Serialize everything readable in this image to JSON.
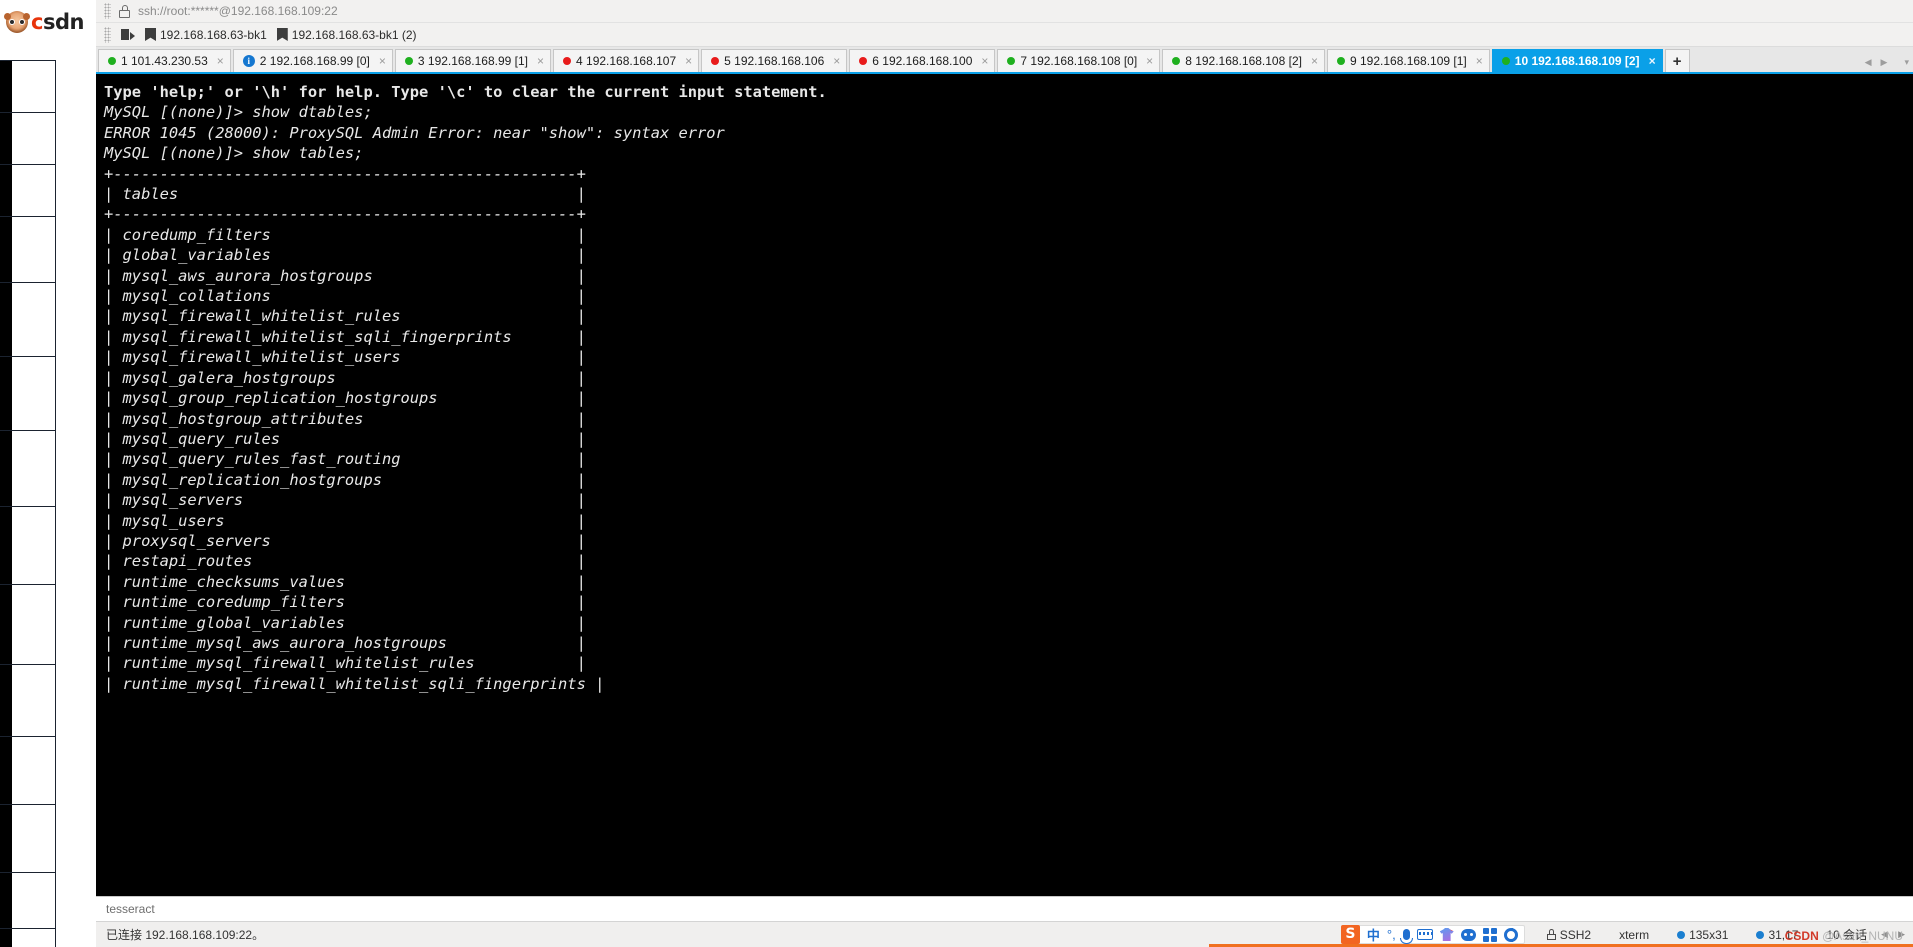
{
  "branding": {
    "logo_text": "csdn",
    "logo_first_letter": "c"
  },
  "addressbar": {
    "lock_icon": "lock-icon",
    "path": "ssh://root:******@192.168.168.109:22"
  },
  "bookmarkbar": {
    "export_icon": "export-session-icon",
    "items": [
      {
        "icon": "bookmark-icon",
        "label": "192.168.168.63-bk1"
      },
      {
        "icon": "bookmark-icon",
        "label": "192.168.168.63-bk1 (2)"
      }
    ]
  },
  "tabs": [
    {
      "index": "1",
      "status": "green",
      "label": "1 101.43.230.53",
      "active": false,
      "close": "×"
    },
    {
      "index": "2",
      "status": "info",
      "label": "2 192.168.168.99 [0]",
      "active": false,
      "close": "×"
    },
    {
      "index": "3",
      "status": "green",
      "label": "3 192.168.168.99 [1]",
      "active": false,
      "close": "×"
    },
    {
      "index": "4",
      "status": "red",
      "label": "4 192.168.168.107",
      "active": false,
      "close": "×"
    },
    {
      "index": "5",
      "status": "red",
      "label": "5 192.168.168.106",
      "active": false,
      "close": "×"
    },
    {
      "index": "6",
      "status": "red",
      "label": "6 192.168.168.100",
      "active": false,
      "close": "×"
    },
    {
      "index": "7",
      "status": "green",
      "label": "7 192.168.168.108 [0]",
      "active": false,
      "close": "×"
    },
    {
      "index": "8",
      "status": "green",
      "label": "8 192.168.168.108 [2]",
      "active": false,
      "close": "×"
    },
    {
      "index": "9",
      "status": "green",
      "label": "9 192.168.168.109 [1]",
      "active": false,
      "close": "×"
    },
    {
      "index": "10",
      "status": "green",
      "label": "10 192.168.168.109 [2]",
      "active": true,
      "close": "×"
    }
  ],
  "tab_add_label": "+",
  "tab_nav": {
    "prev": "◀",
    "next": "▶",
    "list": "▾"
  },
  "terminal": {
    "header_line": "Type 'help;' or '\\h' for help. Type '\\c' to clear the current input statement.",
    "body": "\nMySQL [(none)]> show dtables;\nERROR 1045 (28000): ProxySQL Admin Error: near \"show\": syntax error\nMySQL [(none)]> show tables;\n+--------------------------------------------------+\n| tables                                           |\n+--------------------------------------------------+\n| coredump_filters                                 |\n| global_variables                                 |\n| mysql_aws_aurora_hostgroups                      |\n| mysql_collations                                 |\n| mysql_firewall_whitelist_rules                   |\n| mysql_firewall_whitelist_sqli_fingerprints       |\n| mysql_firewall_whitelist_users                   |\n| mysql_galera_hostgroups                          |\n| mysql_group_replication_hostgroups               |\n| mysql_hostgroup_attributes                       |\n| mysql_query_rules                                |\n| mysql_query_rules_fast_routing                   |\n| mysql_replication_hostgroups                     |\n| mysql_servers                                    |\n| mysql_users                                      |\n| proxysql_servers                                 |\n| restapi_routes                                   |\n| runtime_checksums_values                         |\n| runtime_coredump_filters                         |\n| runtime_global_variables                         |\n| runtime_mysql_aws_aurora_hostgroups              |\n| runtime_mysql_firewall_whitelist_rules           |\n| runtime_mysql_firewall_whitelist_sqli_fingerprints |"
  },
  "input_line": {
    "value": "tesseract"
  },
  "statusbar": {
    "connection_text": "已连接 192.168.168.109:22。",
    "ime": {
      "sogou_logo": "S",
      "mode_cn": "中",
      "punctuation": "°,",
      "mic_icon": "microphone-icon",
      "keyboard_icon": "keyboard-icon",
      "skin_icon": "skin-tshirt-icon",
      "robot_icon": "robot-icon",
      "apps_icon": "apps-grid-icon",
      "settings_icon": "gear-icon"
    },
    "protocol": "SSH2",
    "terminal_type": "xterm",
    "size": "135x31",
    "cursor_pos": "31,17",
    "sessions": "10 会话",
    "size_icon": "arrows-icon",
    "cursor_icon": "caret-icon",
    "lock_icon": "lock-icon"
  },
  "watermark": {
    "prefix": "CSDN",
    "text": " @Asan_NUNU"
  }
}
